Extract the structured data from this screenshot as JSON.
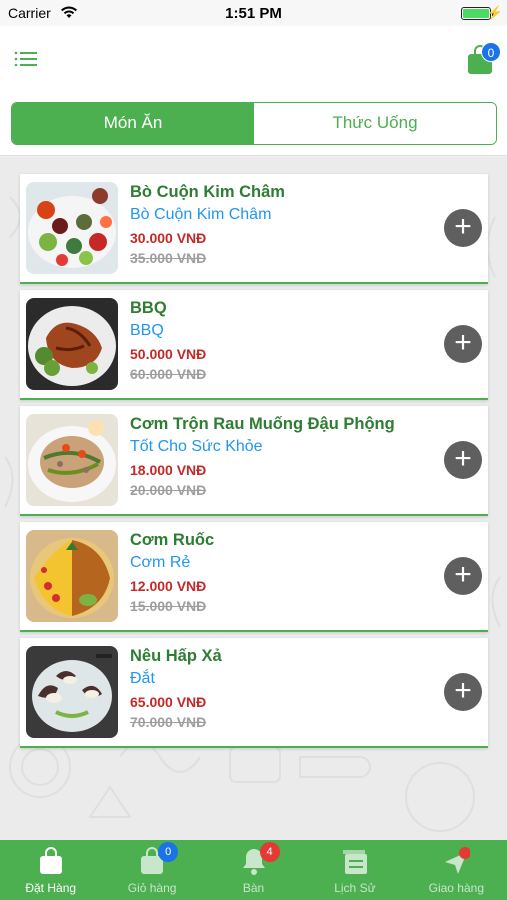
{
  "status_bar": {
    "carrier": "Carrier",
    "time": "1:51 PM",
    "battery_level": 1.0
  },
  "nav": {
    "cart_count": "0"
  },
  "tabs": [
    {
      "label": "Món Ăn",
      "active": true
    },
    {
      "label": "Thức Uống",
      "active": false
    }
  ],
  "items": [
    {
      "name": "Bò Cuộn Kim Châm",
      "desc": "Bò Cuộn Kim Châm",
      "price": "30.000 VNĐ",
      "old_price": "35.000 VNĐ"
    },
    {
      "name": "BBQ",
      "desc": "BBQ",
      "price": "50.000 VNĐ",
      "old_price": "60.000 VNĐ"
    },
    {
      "name": "Cơm Trộn Rau Muống Đậu Phộng",
      "desc": "Tốt Cho Sức Khỏe",
      "price": "18.000 VNĐ",
      "old_price": "20.000 VNĐ"
    },
    {
      "name": "Cơm Ruốc",
      "desc": "Cơm Rẻ",
      "price": "12.000 VNĐ",
      "old_price": "15.000 VNĐ"
    },
    {
      "name": "Nêu Hấp Xả",
      "desc": "Đắt",
      "price": "65.000 VNĐ",
      "old_price": "70.000 VNĐ"
    }
  ],
  "add_label": "+",
  "tab_bar": [
    {
      "label": "Đặt Hàng",
      "icon": "shopping-bag-icon",
      "active": true
    },
    {
      "label": "Giỏ hàng",
      "icon": "cart-bag-icon",
      "badge": "0"
    },
    {
      "label": "Bàn",
      "icon": "bell-icon",
      "badge": "4"
    },
    {
      "label": "Lịch Sử",
      "icon": "history-icon"
    },
    {
      "label": "Giao hàng",
      "icon": "delivery-icon"
    }
  ],
  "colors": {
    "primary_green": "#4caf50",
    "item_name": "#2e7d32",
    "item_desc": "#2196f3",
    "price": "#c62828",
    "old_price": "#9e9e9e",
    "badge_blue": "#1a73e8",
    "badge_red": "#e53935"
  }
}
